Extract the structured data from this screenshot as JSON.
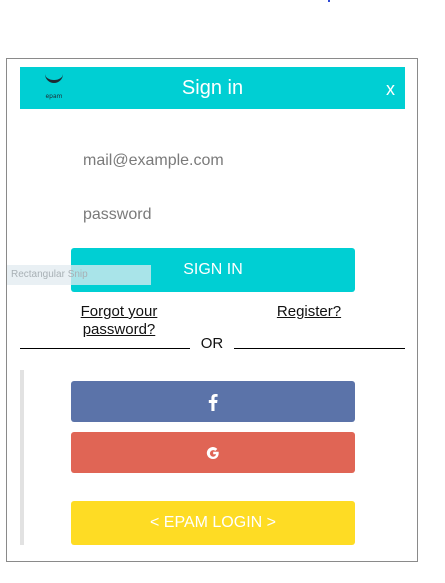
{
  "dialog": {
    "title": "Sign in",
    "close_label": "x",
    "logo_text": "epam"
  },
  "form": {
    "email_placeholder": "mail@example.com",
    "password_placeholder": "password",
    "signin_label": "SIGN IN",
    "forgot_label": "Forgot your password?",
    "register_label": "Register?",
    "or_label": "OR"
  },
  "social": {
    "facebook_icon": "facebook-icon",
    "google_icon": "google-icon",
    "epam_label": "< EPAM LOGIN >"
  },
  "overlay": {
    "snip_label": "Rectangular Snip"
  },
  "colors": {
    "accent": "#00cfd3",
    "facebook": "#5b73a9",
    "google": "#e06555",
    "epam": "#fedc24"
  }
}
